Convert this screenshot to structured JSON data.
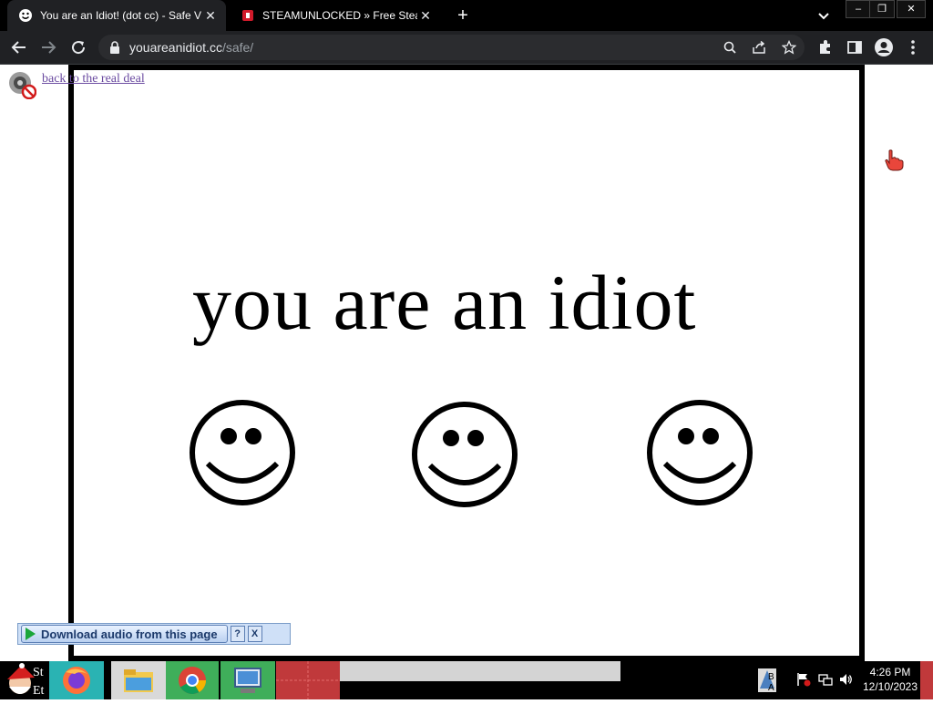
{
  "tabs": [
    {
      "title": "You are an Idiot! (dot cc) - Safe V",
      "active": true,
      "favicon": "smiley-icon"
    },
    {
      "title": "STEAMUNLOCKED » Free Steam G",
      "active": false,
      "favicon": "steamunlocked-icon"
    }
  ],
  "window_controls": {
    "minimize": "–",
    "restore": "❐",
    "close": "✕"
  },
  "omnibox": {
    "domain": "youareanidiot.cc",
    "path": "/safe/"
  },
  "page": {
    "back_link": "back to the real deal",
    "headline": "you are an idiot"
  },
  "download_bar": {
    "label": "Download audio from this page",
    "help": "?",
    "close": "X"
  },
  "taskbar": {
    "time": "4:26 PM",
    "date": "12/10/2023",
    "left_partial_text_1": "St",
    "left_partial_text_2": "Et",
    "notify_partial_text_1": "B",
    "notify_partial_text_2": "A"
  },
  "colors": {
    "chrome_dark": "#202124",
    "tabstrip": "#000000",
    "link": "#6b4ba1",
    "frame": "#000000",
    "download_bar": "#cfe0f7"
  }
}
